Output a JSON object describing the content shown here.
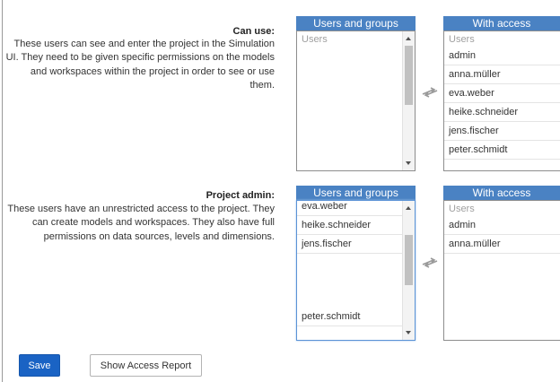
{
  "can_use": {
    "title": "Can use:",
    "description": "These users can see and enter the project in the Simulation UI. They need to be given specific permissions on the models and workspaces within the project in order to see or use them.",
    "available": {
      "header": "Users and groups",
      "caption": "Users",
      "items": []
    },
    "with_access": {
      "header": "With access",
      "caption": "Users",
      "items": [
        "admin",
        "anna.müller",
        "eva.weber",
        "heike.schneider",
        "jens.fischer",
        "peter.schmidt"
      ]
    }
  },
  "project_admin": {
    "title": "Project admin:",
    "description": "These users have an unrestricted access to the project. They can create models and workspaces. They also have full permissions on data sources, levels and dimensions.",
    "available": {
      "header": "Users and groups",
      "items": [
        "eva.weber",
        "heike.schneider",
        "jens.fischer",
        "",
        "",
        "",
        "peter.schmidt"
      ]
    },
    "with_access": {
      "header": "With access",
      "caption": "Users",
      "items": [
        "admin",
        "anna.müller"
      ]
    }
  },
  "buttons": {
    "save": "Save",
    "report": "Show Access Report"
  }
}
